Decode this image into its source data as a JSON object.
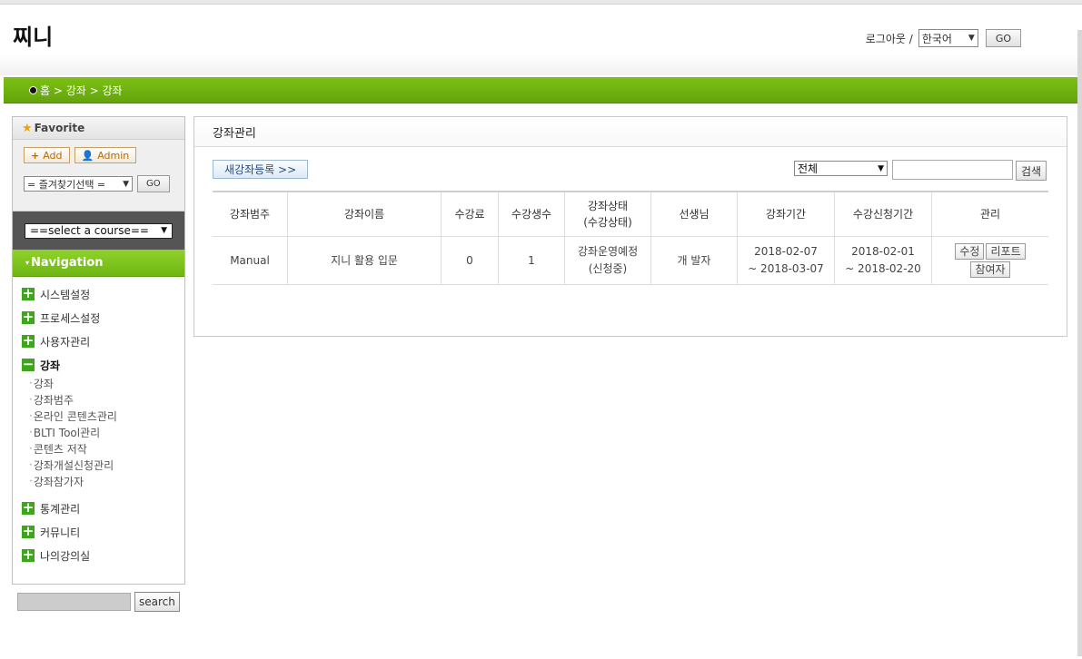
{
  "header": {
    "site_title": "찌니",
    "logout": "로그아웃 /",
    "language_value": "한국어",
    "go_label": "GO"
  },
  "breadcrumb": "홈 > 강좌 > 강좌",
  "favorite": {
    "title": "Favorite",
    "add_label": "Add",
    "admin_label": "Admin",
    "select_value": "= 즐겨찾기선택 =",
    "go_label": "GO"
  },
  "course_select": "==select a course==",
  "navigation": {
    "title": "Navigation",
    "items": [
      {
        "label": "시스템설정"
      },
      {
        "label": "프로세스설정"
      },
      {
        "label": "사용자관리"
      },
      {
        "label": "강좌"
      },
      {
        "label": "통계관리"
      },
      {
        "label": "커뮤니티"
      },
      {
        "label": "나의강의실"
      }
    ],
    "sub_items": [
      "강좌",
      "강좌범주",
      "온라인 콘텐츠관리",
      "BLTI Tool관리",
      "콘텐츠 저작",
      "강좌개설신청관리",
      "강좌참가자"
    ]
  },
  "sidebar_search": {
    "button": "search"
  },
  "main": {
    "title": "강좌관리",
    "new_course_button": "새강좌등록 >>",
    "filter_value": "전체",
    "search_button": "검색",
    "columns": [
      "강좌범주",
      "강좌이름",
      "수강료",
      "수강생수",
      "강좌상태",
      "(수강상태)",
      "선생님",
      "강좌기간",
      "수강신청기간",
      "관리"
    ],
    "rows": [
      {
        "category": "Manual",
        "name": "지니 활용 입문",
        "fee": "0",
        "students": "1",
        "status": "강좌운영예정",
        "enroll_status": "(신청중)",
        "teacher": "개 발자",
        "period_start": "2018-02-07",
        "period_end": "~ 2018-03-07",
        "apply_start": "2018-02-01",
        "apply_end": "~ 2018-02-20",
        "actions": [
          "수정",
          "리포트",
          "참여자"
        ]
      }
    ]
  },
  "colors": {
    "brand_green": "#6fb612",
    "icon_green": "#3ea51d"
  }
}
